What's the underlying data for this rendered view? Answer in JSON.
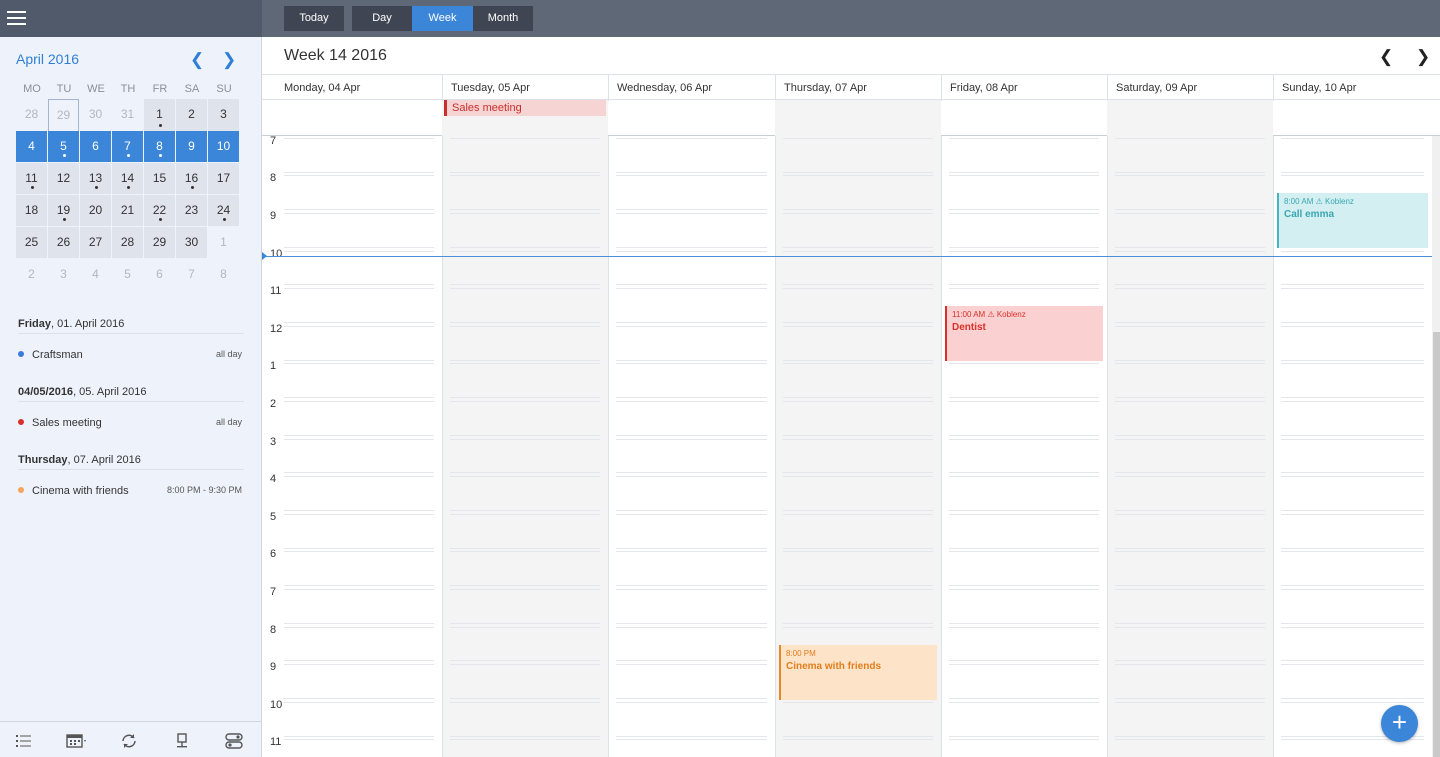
{
  "toolbar": {
    "today_label": "Today",
    "views": [
      {
        "label": "Day",
        "active": false
      },
      {
        "label": "Week",
        "active": true
      },
      {
        "label": "Month",
        "active": false
      }
    ],
    "menu_icon": "hamburger-icon"
  },
  "mini_calendar": {
    "title": "April 2016",
    "weekdays": [
      "MO",
      "TU",
      "WE",
      "TH",
      "FR",
      "SA",
      "SU"
    ],
    "weeks": [
      [
        {
          "d": "28",
          "s": "out"
        },
        {
          "d": "29",
          "s": "today"
        },
        {
          "d": "30",
          "s": "out"
        },
        {
          "d": "31",
          "s": "out"
        },
        {
          "d": "1",
          "s": "shade",
          "dot": true
        },
        {
          "d": "2",
          "s": "shade"
        },
        {
          "d": "3",
          "s": "shade"
        }
      ],
      [
        {
          "d": "4",
          "s": "sel"
        },
        {
          "d": "5",
          "s": "sel",
          "dot": true
        },
        {
          "d": "6",
          "s": "sel"
        },
        {
          "d": "7",
          "s": "sel",
          "dot": true
        },
        {
          "d": "8",
          "s": "sel",
          "dot": true
        },
        {
          "d": "9",
          "s": "sel"
        },
        {
          "d": "10",
          "s": "sel"
        }
      ],
      [
        {
          "d": "11",
          "s": "shade",
          "dot": true
        },
        {
          "d": "12",
          "s": "shade"
        },
        {
          "d": "13",
          "s": "shade",
          "dot": true
        },
        {
          "d": "14",
          "s": "shade",
          "dot": true
        },
        {
          "d": "15",
          "s": "shade"
        },
        {
          "d": "16",
          "s": "shade",
          "dot": true
        },
        {
          "d": "17",
          "s": "shade"
        }
      ],
      [
        {
          "d": "18",
          "s": "shade"
        },
        {
          "d": "19",
          "s": "shade",
          "dot": true
        },
        {
          "d": "20",
          "s": "shade"
        },
        {
          "d": "21",
          "s": "shade"
        },
        {
          "d": "22",
          "s": "shade",
          "dot": true
        },
        {
          "d": "23",
          "s": "shade"
        },
        {
          "d": "24",
          "s": "shade",
          "dot": true
        }
      ],
      [
        {
          "d": "25",
          "s": "shade"
        },
        {
          "d": "26",
          "s": "shade"
        },
        {
          "d": "27",
          "s": "shade"
        },
        {
          "d": "28",
          "s": "shade"
        },
        {
          "d": "29",
          "s": "shade"
        },
        {
          "d": "30",
          "s": "shade"
        },
        {
          "d": "1",
          "s": "out"
        }
      ],
      [
        {
          "d": "2",
          "s": "out"
        },
        {
          "d": "3",
          "s": "out"
        },
        {
          "d": "4",
          "s": "out"
        },
        {
          "d": "5",
          "s": "out"
        },
        {
          "d": "6",
          "s": "out"
        },
        {
          "d": "7",
          "s": "out"
        },
        {
          "d": "8",
          "s": "out"
        }
      ]
    ]
  },
  "agenda": [
    {
      "day_bold": "Friday",
      "day_rest": ", 01. April 2016",
      "event": "Craftsman",
      "time": "all day",
      "color": "#3b7be0"
    },
    {
      "day_bold": "04/05/2016",
      "day_rest": ", 05. April 2016",
      "event": "Sales meeting",
      "time": "all day",
      "color": "#d9302c"
    },
    {
      "day_bold": "Thursday",
      "day_rest": ", 07. April 2016",
      "event": "Cinema with friends",
      "time": "8:00 PM - 9:30 PM",
      "color": "#f5a55a"
    }
  ],
  "bottom_icons": [
    "list-icon",
    "calendar-grid-icon",
    "sync-icon",
    "pin-icon",
    "toggle-icon"
  ],
  "week": {
    "title": "Week 14 2016",
    "days": [
      "Monday, 04 Apr",
      "Tuesday, 05 Apr",
      "Wednesday, 06 Apr",
      "Thursday, 07 Apr",
      "Friday, 08 Apr",
      "Saturday, 09 Apr",
      "Sunday, 10 Apr"
    ],
    "hours": [
      "7",
      "8",
      "9",
      "10",
      "11",
      "12",
      "1",
      "2",
      "3",
      "4",
      "5",
      "6",
      "7",
      "8",
      "9",
      "10",
      "11"
    ]
  },
  "allday_events": [
    {
      "day": 1,
      "title": "Sales meeting",
      "bg": "#f7d4d4",
      "border": "#c9302c",
      "color": "#c9302c"
    }
  ],
  "events": [
    {
      "day": 6,
      "start": 8,
      "end": 9.5,
      "time": "8:00 AM",
      "location": "Koblenz",
      "title": "Call emma",
      "bg": "#d4eff2",
      "border": "#46b5bf",
      "color": "#3aa6b0"
    },
    {
      "day": 4,
      "start": 11,
      "end": 12.5,
      "time": "11:00 AM",
      "location": "Koblenz",
      "title": "Dentist",
      "bg": "#fbd0d0",
      "border": "#d9302c",
      "color": "#d9302c"
    },
    {
      "day": 3,
      "start": 20,
      "end": 21.5,
      "time": "8:00 PM",
      "location": "",
      "title": "Cinema with friends",
      "bg": "#fde3c8",
      "border": "#e58a2a",
      "color": "#e07e1e"
    }
  ],
  "current_time": 10.1
}
